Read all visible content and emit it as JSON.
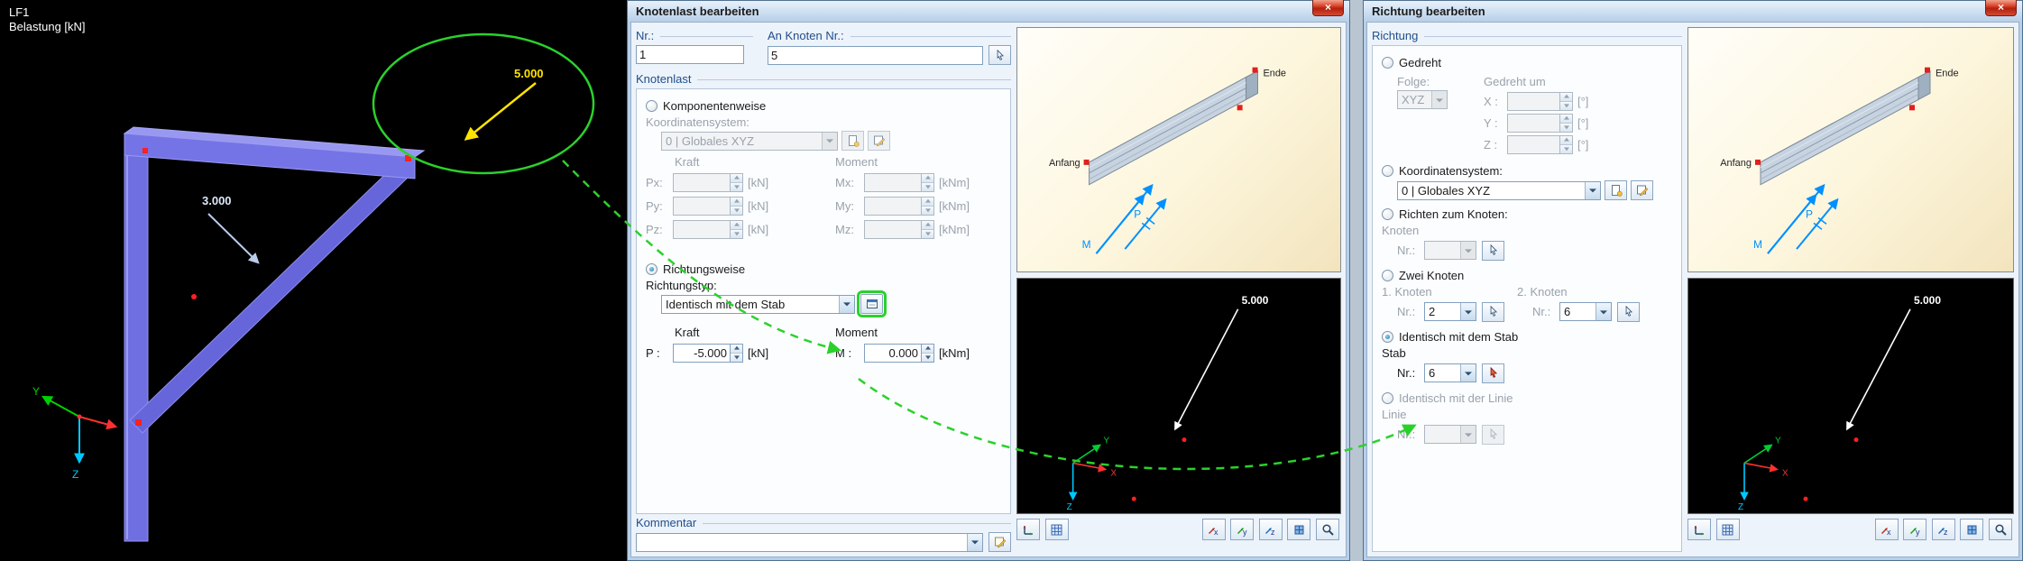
{
  "icons": {
    "close": "×"
  },
  "viewport": {
    "loadcase": "LF1",
    "loadcase_unit": "Belastung [kN]",
    "load_value_top": "5.000",
    "load_value_mid": "3.000",
    "axis_y": "Y",
    "axis_z": "Z"
  },
  "beam_preview": {
    "anfang": "Anfang",
    "ende": "Ende",
    "p": "P",
    "m": "M"
  },
  "black_preview": {
    "value": "5.000",
    "axis_x": "X",
    "axis_y": "Y",
    "axis_z": "Z"
  },
  "toolbar": {
    "x": "x",
    "y": "y",
    "z": "z"
  },
  "knotenlast": {
    "title": "Knotenlast bearbeiten",
    "nr_caption": "Nr.:",
    "nr_value": "1",
    "node_caption": "An Knoten Nr.:",
    "node_value": "5",
    "group_title": "Knotenlast",
    "opt_komponentenweise": "Komponentenweise",
    "lbl_koordinatensystem": "Koordinatensystem:",
    "koordinatensystem_value": "0 | Globales XYZ",
    "hdr_kraft": "Kraft",
    "hdr_moment": "Moment",
    "force_labels": {
      "px": "Px:",
      "py": "Py:",
      "pz": "Pz:",
      "mx": "Mx:",
      "my": "My:",
      "mz": "Mz:"
    },
    "unit_kn": "[kN]",
    "unit_knm": "[kNm]",
    "opt_richtungsweise": "Richtungsweise",
    "lbl_richtungstyp": "Richtungstyp:",
    "richtungstyp_value": "Identisch mit dem Stab",
    "lbl_p": "P :",
    "p_value": "-5.000",
    "lbl_m": "M :",
    "m_value": "0.000",
    "group_kommentar": "Kommentar"
  },
  "richtung": {
    "title": "Richtung bearbeiten",
    "group_title": "Richtung",
    "opt_gedreht": "Gedreht",
    "lbl_folge": "Folge:",
    "folge_value": "XYZ",
    "lbl_gedreht_um": "Gedreht um",
    "lbl_x": "X :",
    "lbl_y": "Y :",
    "lbl_z": "Z :",
    "unit_deg": "[°]",
    "opt_koordinatensystem": "Koordinatensystem:",
    "koordinatensystem_value": "0 | Globales XYZ",
    "opt_richten": "Richten zum Knoten:",
    "lbl_knoten": "Knoten",
    "lbl_nr": "Nr.:",
    "opt_zwei_knoten": "Zwei Knoten",
    "lbl_knoten1": "1. Knoten",
    "lbl_knoten2": "2. Knoten",
    "knoten1_value": "2",
    "knoten2_value": "6",
    "opt_identisch_stab": "Identisch mit dem Stab",
    "lbl_stab": "Stab",
    "stab_value": "6",
    "opt_identisch_linie": "Identisch mit der Linie",
    "lbl_linie": "Linie"
  }
}
